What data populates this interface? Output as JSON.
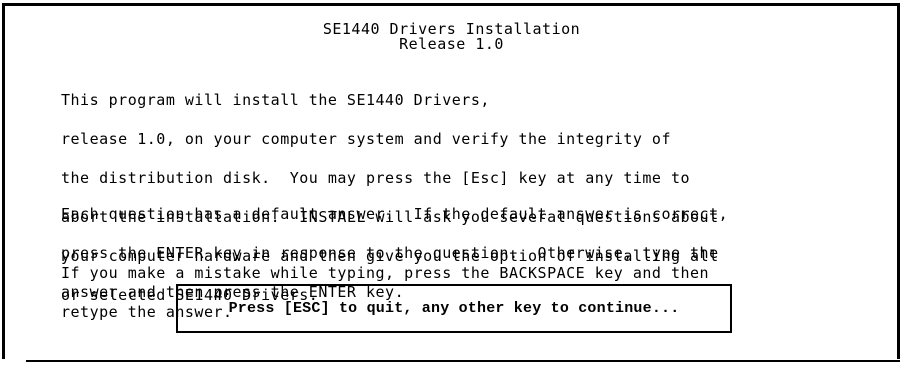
{
  "title": {
    "line1": "SE1440 Drivers Installation",
    "line2": "Release 1.0"
  },
  "paragraphs": {
    "intro": [
      "This program will install the SE1440 Drivers,",
      "release 1.0, on your computer system and verify the integrity of",
      "the distribution disk.  You may press the [Esc] key at any time to",
      "abort the installation.  INSTALL will ask you several questions about",
      "your computer hardware and then give you the option of installing all",
      "or selected SE1440 Drivers."
    ],
    "defaults": [
      "Each question has a default answer.  If the default answer is correct,",
      "press the ENTER key in response to the question.  Otherwise, type the",
      "answer and then press the ENTER key."
    ],
    "mistakes": [
      "If you make a mistake while typing, press the BACKSPACE key and then",
      "retype the answer."
    ]
  },
  "prompt": {
    "text": "Press [ESC] to quit, any other key to continue..."
  }
}
